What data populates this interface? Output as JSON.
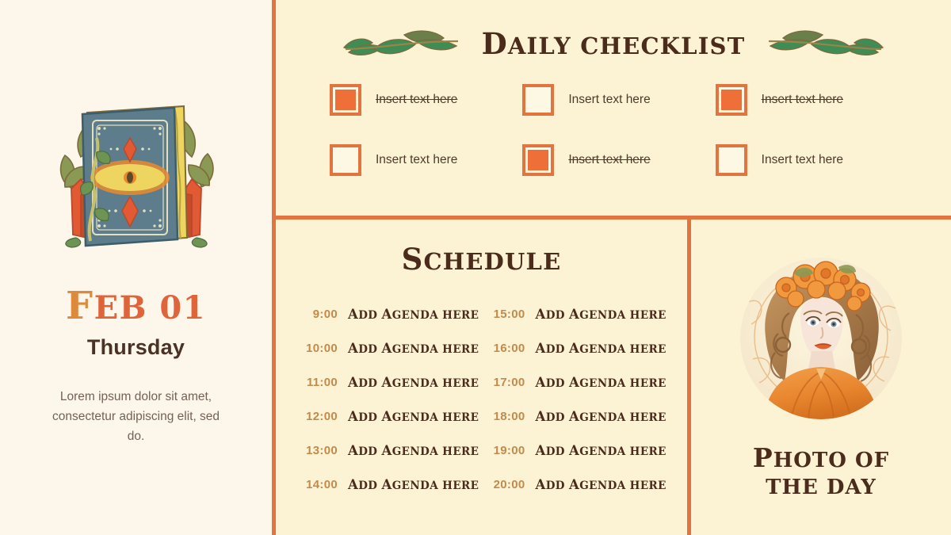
{
  "sidebar": {
    "illustration_name": "mystical-book-illustration",
    "date": "Feb 01",
    "date_initial": "F",
    "date_rest": "eb 01",
    "weekday": "Thursday",
    "description": "Lorem ipsum dolor sit amet, consectetur adipiscing elit, sed do."
  },
  "checklist": {
    "title": "Daily Checklist",
    "title_initial": "D",
    "title_rest": "aily Checklist",
    "ornament_left": "leaf-flourish-left",
    "ornament_right": "leaf-flourish-right",
    "items": [
      {
        "label": "Insert text here",
        "checked": true
      },
      {
        "label": "Insert text here",
        "checked": false
      },
      {
        "label": "Insert text here",
        "checked": true
      },
      {
        "label": "Insert text here",
        "checked": false
      },
      {
        "label": "Insert text here",
        "checked": true
      },
      {
        "label": "Insert text here",
        "checked": false
      }
    ]
  },
  "schedule": {
    "title": "Schedule",
    "title_initial": "S",
    "title_rest": "chedule",
    "agenda_initial": "A",
    "rows": [
      {
        "time": "9:00",
        "agenda": "Add Agenda here",
        "a1": "A",
        "a1rest": "dd ",
        "a2": "A",
        "a2rest": "genda here"
      },
      {
        "time": "15:00",
        "agenda": "Add Agenda here",
        "a1": "A",
        "a1rest": "dd ",
        "a2": "A",
        "a2rest": "genda here"
      },
      {
        "time": "10:00",
        "agenda": "Add Agenda here",
        "a1": "A",
        "a1rest": "dd ",
        "a2": "A",
        "a2rest": "genda here"
      },
      {
        "time": "16:00",
        "agenda": "Add Agenda here",
        "a1": "A",
        "a1rest": "dd ",
        "a2": "A",
        "a2rest": "genda here"
      },
      {
        "time": "11:00",
        "agenda": "Add Agenda here",
        "a1": "A",
        "a1rest": "dd ",
        "a2": "A",
        "a2rest": "genda here"
      },
      {
        "time": "17:00",
        "agenda": "Add Agenda here",
        "a1": "A",
        "a1rest": "dd ",
        "a2": "A",
        "a2rest": "genda here"
      },
      {
        "time": "12:00",
        "agenda": "Add Agenda here",
        "a1": "A",
        "a1rest": "dd ",
        "a2": "A",
        "a2rest": "genda here"
      },
      {
        "time": "18:00",
        "agenda": "Add Agenda here",
        "a1": "A",
        "a1rest": "dd ",
        "a2": "A",
        "a2rest": "genda here"
      },
      {
        "time": "13:00",
        "agenda": "Add Agenda here",
        "a1": "A",
        "a1rest": "dd ",
        "a2": "A",
        "a2rest": "genda here"
      },
      {
        "time": "19:00",
        "agenda": "Add Agenda here",
        "a1": "A",
        "a1rest": "dd ",
        "a2": "A",
        "a2rest": "genda here"
      },
      {
        "time": "14:00",
        "agenda": "Add Agenda here",
        "a1": "A",
        "a1rest": "dd ",
        "a2": "A",
        "a2rest": "genda here"
      },
      {
        "time": "20:00",
        "agenda": "Add Agenda here",
        "a1": "A",
        "a1rest": "dd ",
        "a2": "A",
        "a2rest": "genda here"
      }
    ]
  },
  "photo": {
    "image_name": "art-nouveau-woman-portrait",
    "caption_line1": "Photo of",
    "caption_line1_initial": "P",
    "caption_line1_rest": "hoto of",
    "caption_line2": "the Day"
  },
  "colors": {
    "accent_orange": "#e2753f",
    "checkbox_fill": "#ee6f37",
    "sidebar_bg": "#fdf6ea",
    "main_bg": "#fcf3d5",
    "title_brown": "#4a2b1c",
    "time_gold": "#c28a4c",
    "date_orange": "#e0643a",
    "leaf_green": "#4e9561"
  }
}
